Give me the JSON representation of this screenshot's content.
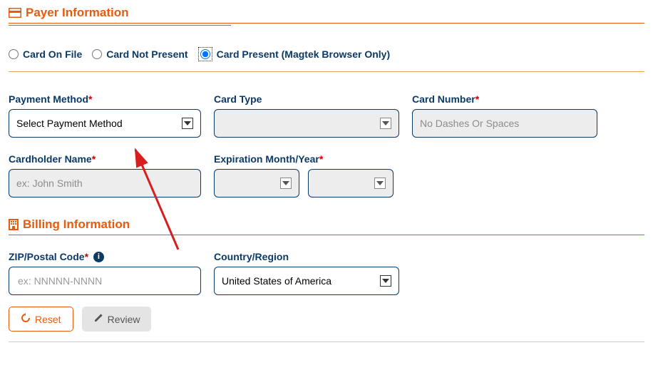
{
  "payer": {
    "title": "Payer Information",
    "radios": {
      "on_file": "Card On File",
      "not_present": "Card Not Present",
      "present": "Card Present (Magtek Browser Only)"
    }
  },
  "fields": {
    "payment_method_label": "Payment Method",
    "payment_method_placeholder": "Select Payment Method",
    "card_type_label": "Card Type",
    "card_number_label": "Card Number",
    "card_number_placeholder": "No Dashes Or Spaces",
    "cardholder_label": "Cardholder Name",
    "cardholder_placeholder": "ex: John Smith",
    "expiration_label": "Expiration Month/Year"
  },
  "billing": {
    "title": "Billing Information",
    "zip_label": "ZIP/Postal Code",
    "zip_placeholder": "ex: NNNNN-NNNN",
    "country_label": "Country/Region",
    "country_value": "United States of America"
  },
  "buttons": {
    "reset": "Reset",
    "review": "Review"
  },
  "glyphs": {
    "required": "*",
    "info": "i"
  }
}
